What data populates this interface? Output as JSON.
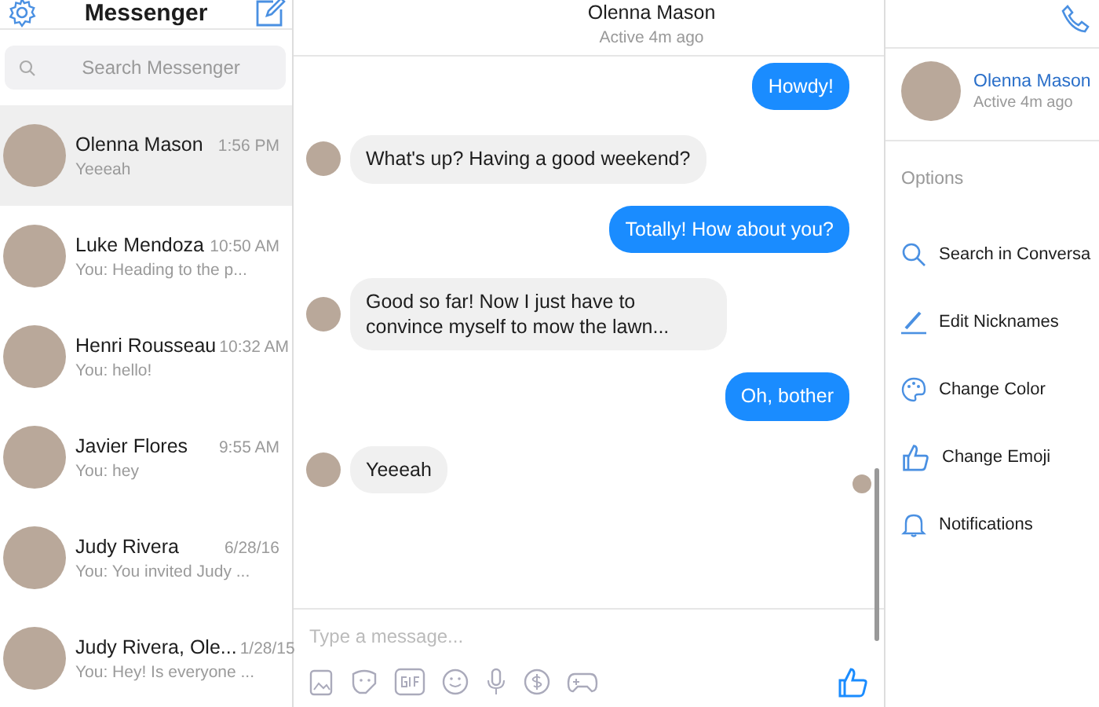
{
  "sidebar": {
    "title": "Messenger",
    "search": {
      "placeholder": "Search Messenger"
    },
    "conversations": [
      {
        "name": "Olenna Mason",
        "time": "1:56 PM",
        "preview": "Yeeeah",
        "selected": true
      },
      {
        "name": "Luke Mendoza",
        "time": "10:50 AM",
        "preview": "You: Heading to the p...",
        "selected": false
      },
      {
        "name": "Henri Rousseau",
        "time": "10:32 AM",
        "preview": "You: hello!",
        "selected": false
      },
      {
        "name": "Javier Flores",
        "time": "9:55 AM",
        "preview": "You: hey",
        "selected": false
      },
      {
        "name": "Judy Rivera",
        "time": "6/28/16",
        "preview": "You: You invited Judy ...",
        "selected": false
      },
      {
        "name": "Judy Rivera, Ole...",
        "time": "1/28/15",
        "preview": "You: Hey! Is everyone ...",
        "selected": false
      }
    ]
  },
  "chat": {
    "name": "Olenna Mason",
    "status": "Active 4m ago",
    "messages": [
      {
        "kind": "out",
        "text": "Howdy!"
      },
      {
        "kind": "in",
        "text": "What's up? Having a good weekend?"
      },
      {
        "kind": "out",
        "text": "Totally! How about you?"
      },
      {
        "kind": "in",
        "text": "Good so far! Now I just have to convince myself to mow the lawn..."
      },
      {
        "kind": "out",
        "text": "Oh, bother"
      },
      {
        "kind": "in",
        "text": "Yeeeah",
        "seen": true
      }
    ],
    "composer": {
      "placeholder": "Type a message..."
    }
  },
  "details": {
    "name": "Olenna Mason",
    "status": "Active 4m ago",
    "options_heading": "Options",
    "options": [
      {
        "kind": "search",
        "label": "Search in Conversa"
      },
      {
        "kind": "pencil",
        "label": "Edit Nicknames"
      },
      {
        "kind": "palette",
        "label": "Change Color"
      },
      {
        "kind": "thumb",
        "label": "Change Emoji"
      },
      {
        "kind": "bell",
        "label": "Notifications"
      }
    ]
  }
}
